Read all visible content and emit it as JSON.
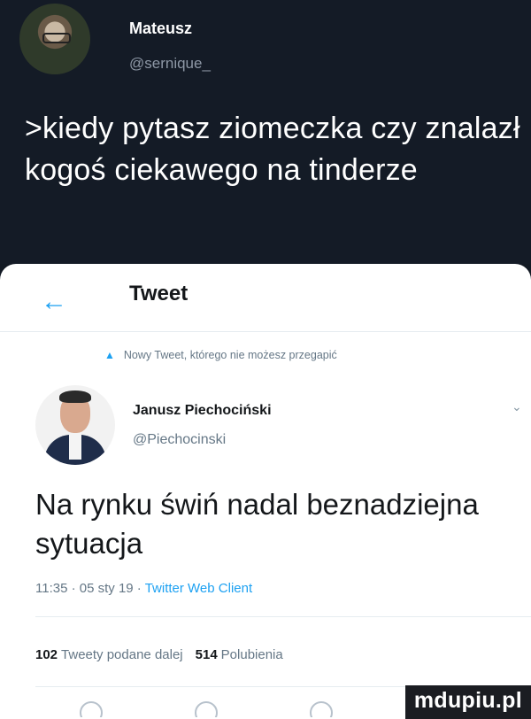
{
  "author": {
    "name": "Mateusz",
    "handle": "@sernique_"
  },
  "meme_text": ">kiedy pytasz ziomeczka czy znalazł kogoś ciekawego na tinderze",
  "screenshot": {
    "header_title": "Tweet",
    "notice": "Nowy Tweet, którego nie możesz przegapić",
    "tweet": {
      "author_name": "Janusz Piechociński",
      "author_handle": "@Piechocinski",
      "text": "Na rynku świń nadal beznadziejna sytuacja",
      "time": "11:35 · 05 sty 19 ·",
      "source": "Twitter Web Client",
      "retweets_count": "102",
      "retweets_label": "Tweety podane dalej",
      "likes_count": "514",
      "likes_label": "Polubienia"
    }
  },
  "watermark": "mdupiu.pl",
  "colors": {
    "dark_background": "#141b26",
    "accent": "#1da1f2",
    "muted": "#657786"
  },
  "icons": [
    "back-arrow-icon",
    "twitter-bird-icon",
    "chevron-down-icon",
    "reply-icon",
    "retweet-icon",
    "like-icon",
    "share-icon"
  ]
}
